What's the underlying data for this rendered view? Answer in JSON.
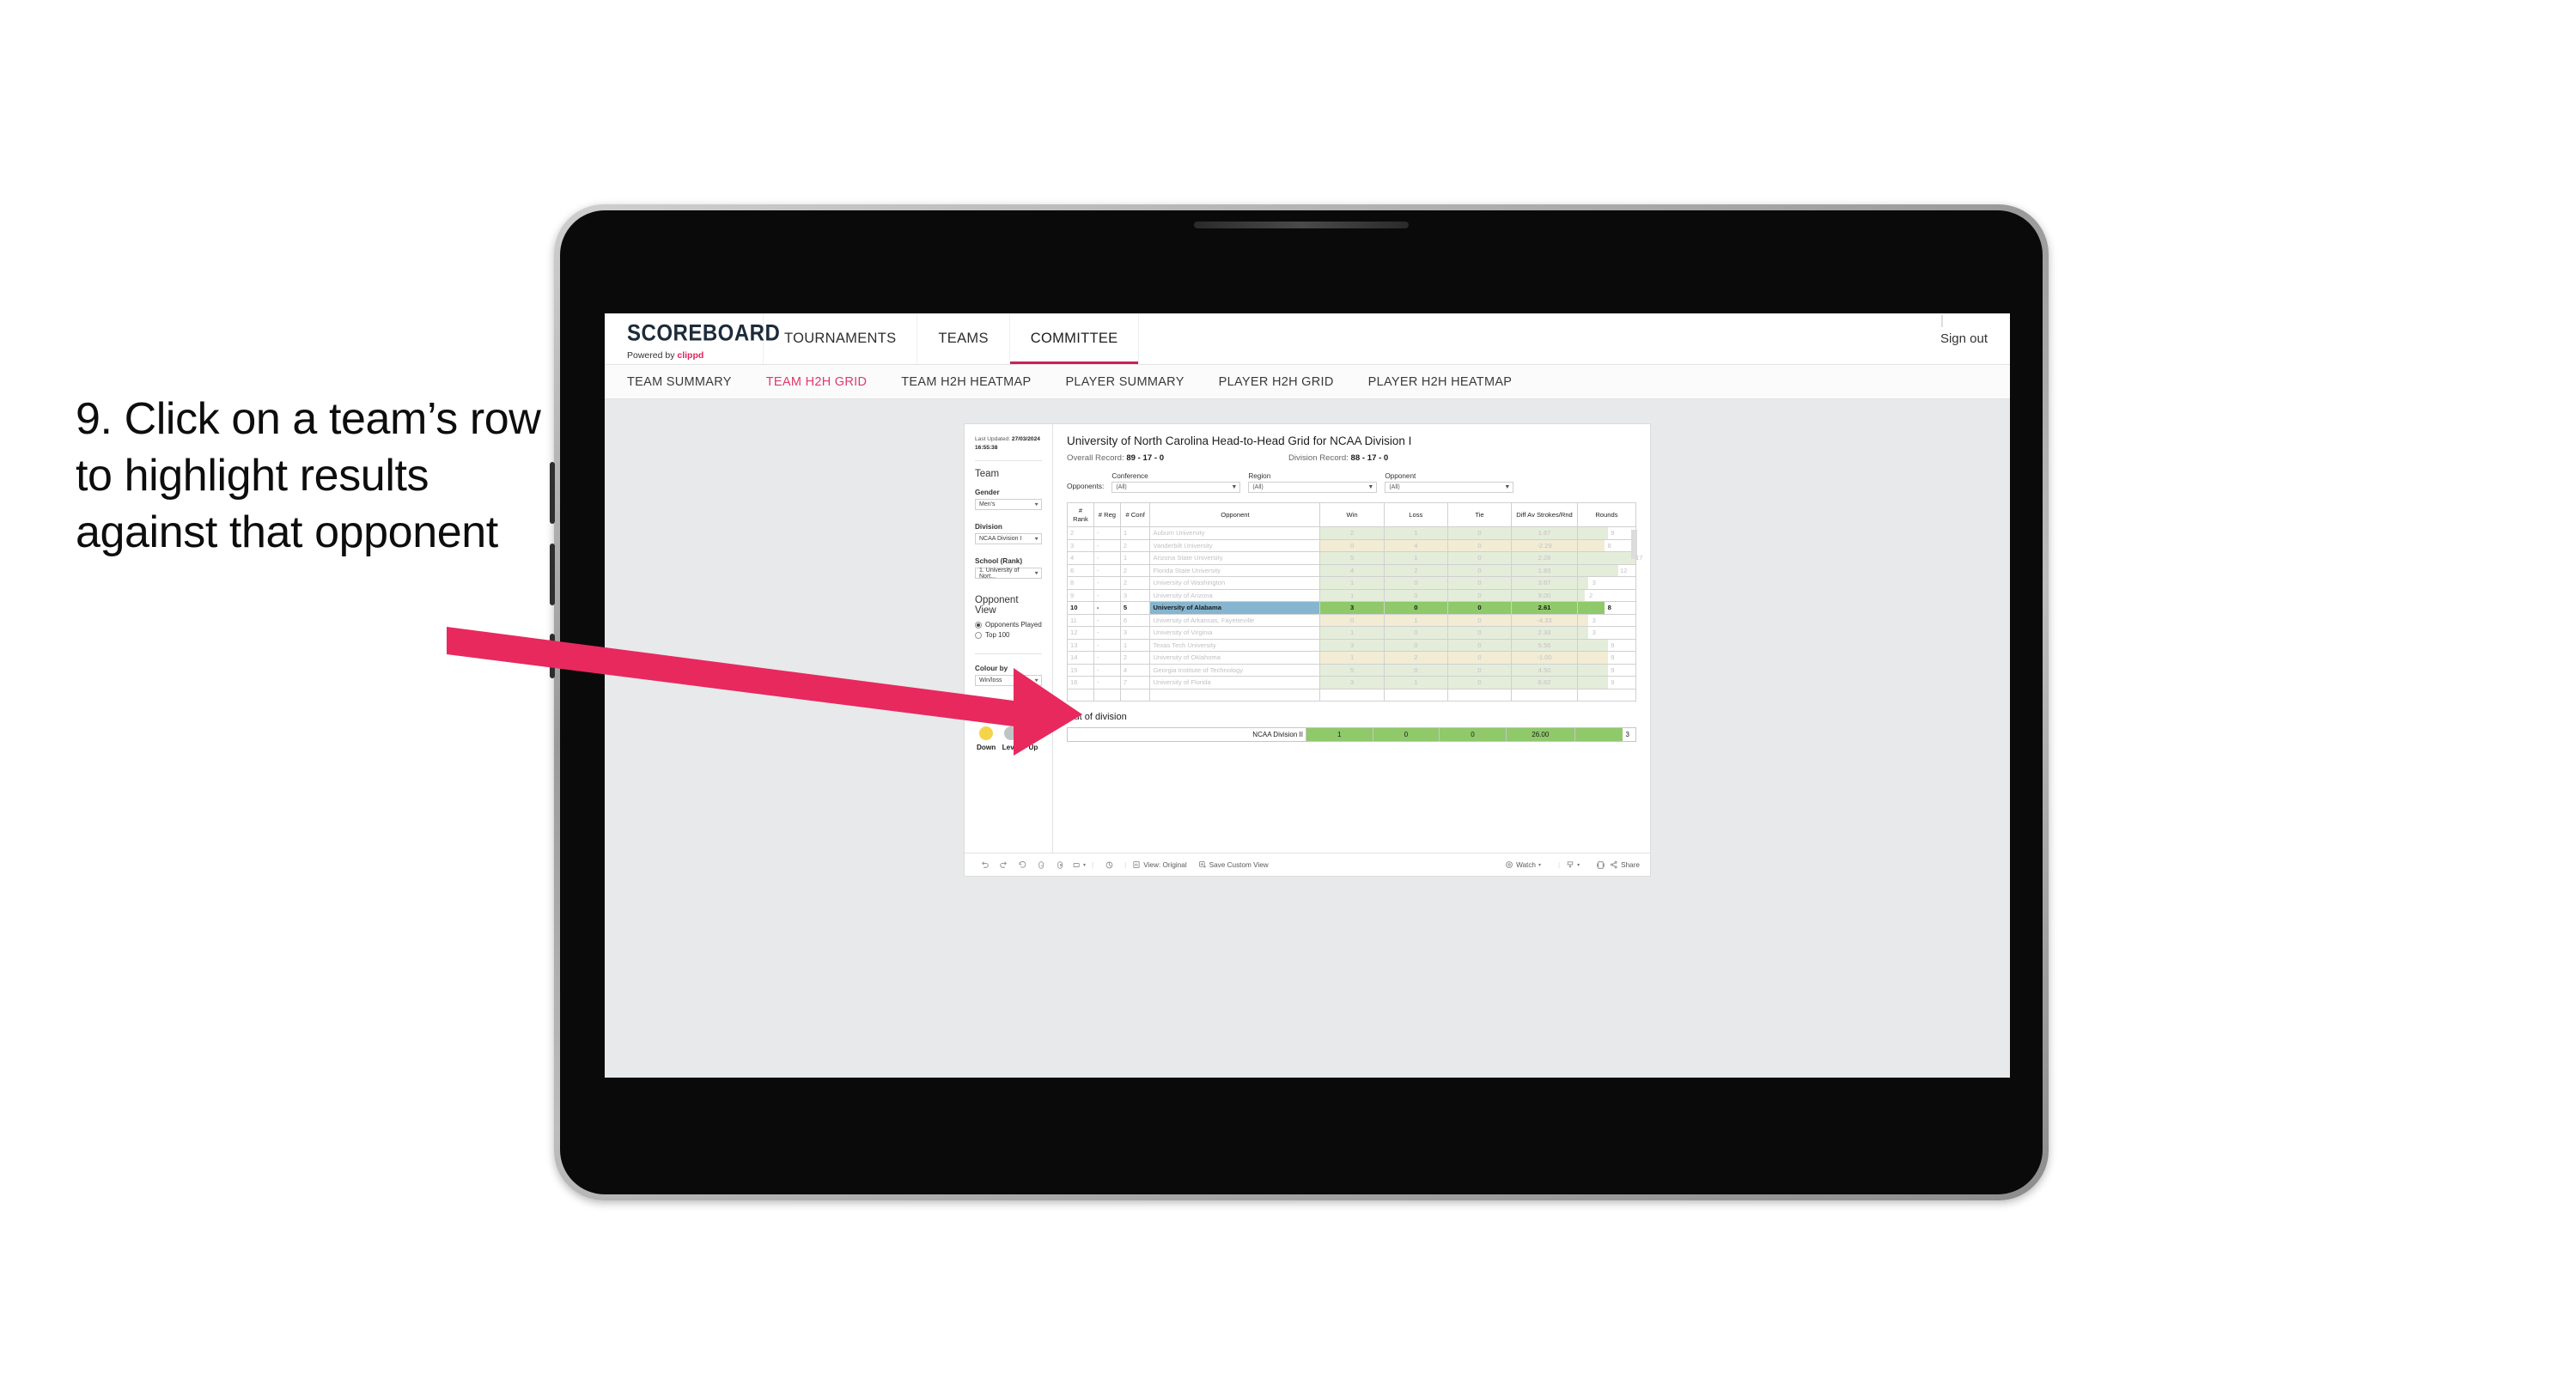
{
  "caption": {
    "text": "9. Click on a team’s row to highlight results against that opponent"
  },
  "app": {
    "brand": {
      "title": "SCOREBOARD",
      "powered_by": "Powered by",
      "vendor": "clippd"
    },
    "top_nav": [
      {
        "label": "TOURNAMENTS",
        "active": false
      },
      {
        "label": "TEAMS",
        "active": false
      },
      {
        "label": "COMMITTEE",
        "active": true
      }
    ],
    "sign_out": "Sign out",
    "sub_nav": [
      {
        "label": "TEAM SUMMARY",
        "active": false
      },
      {
        "label": "TEAM H2H GRID",
        "active": true
      },
      {
        "label": "TEAM H2H HEATMAP",
        "active": false
      },
      {
        "label": "PLAYER SUMMARY",
        "active": false
      },
      {
        "label": "PLAYER H2H GRID",
        "active": false
      },
      {
        "label": "PLAYER H2H HEATMAP",
        "active": false
      }
    ]
  },
  "sidebar": {
    "last_updated_label": "Last Updated:",
    "last_updated_value": "27/03/2024 16:55:38",
    "team_heading": "Team",
    "gender_label": "Gender",
    "gender_value": "Men’s",
    "division_label": "Division",
    "division_value": "NCAA Division I",
    "school_label": "School (Rank)",
    "school_value": "1. University of Nort...",
    "opponent_view_heading": "Opponent View",
    "opponent_view_options": [
      {
        "label": "Opponents Played",
        "selected": true
      },
      {
        "label": "Top 100",
        "selected": false
      }
    ],
    "colour_by_label": "Colour by",
    "colour_by_value": "Win/loss",
    "legend": [
      {
        "label": "Down",
        "color": "#f5d44c"
      },
      {
        "label": "Level",
        "color": "#c0c4c7"
      },
      {
        "label": "Up",
        "color": "#8ac565"
      }
    ]
  },
  "main": {
    "title": "University of North Carolina Head-to-Head Grid for NCAA Division I",
    "overall_record_label": "Overall Record:",
    "overall_record_value": "89 - 17 - 0",
    "division_record_label": "Division Record:",
    "division_record_value": "88 - 17 - 0",
    "opponents_label": "Opponents:",
    "filters": [
      {
        "label": "Conference",
        "value": "(All)"
      },
      {
        "label": "Region",
        "value": "(All)"
      },
      {
        "label": "Opponent",
        "value": "(All)"
      }
    ],
    "columns": [
      "# Rank",
      "# Reg",
      "# Conf",
      "Opponent",
      "Win",
      "Loss",
      "Tie",
      "Diff Av Strokes/Rnd",
      "Rounds"
    ],
    "rows": [
      {
        "rank": "2",
        "reg": "-",
        "conf": "1",
        "opponent": "Auburn University",
        "win": "2",
        "loss": "1",
        "tie": "0",
        "diff": "1.67",
        "rounds": "9",
        "tone": "up",
        "selected": false
      },
      {
        "rank": "3",
        "reg": "-",
        "conf": "2",
        "opponent": "Vanderbilt University",
        "win": "0",
        "loss": "4",
        "tie": "0",
        "diff": "-2.29",
        "rounds": "8",
        "tone": "down",
        "selected": false
      },
      {
        "rank": "4",
        "reg": "-",
        "conf": "1",
        "opponent": "Arizona State University",
        "win": "5",
        "loss": "1",
        "tie": "0",
        "diff": "2.28",
        "rounds": "17",
        "tone": "up",
        "selected": false
      },
      {
        "rank": "6",
        "reg": "-",
        "conf": "2",
        "opponent": "Florida State University",
        "win": "4",
        "loss": "2",
        "tie": "0",
        "diff": "1.83",
        "rounds": "12",
        "tone": "up",
        "selected": false
      },
      {
        "rank": "8",
        "reg": "-",
        "conf": "2",
        "opponent": "University of Washington",
        "win": "1",
        "loss": "0",
        "tie": "0",
        "diff": "3.67",
        "rounds": "3",
        "tone": "up",
        "selected": false
      },
      {
        "rank": "9",
        "reg": "-",
        "conf": "3",
        "opponent": "University of Arizona",
        "win": "1",
        "loss": "0",
        "tie": "0",
        "diff": "9.00",
        "rounds": "2",
        "tone": "up",
        "selected": false
      },
      {
        "rank": "10",
        "reg": "-",
        "conf": "5",
        "opponent": "University of Alabama",
        "win": "3",
        "loss": "0",
        "tie": "0",
        "diff": "2.61",
        "rounds": "8",
        "tone": "up",
        "selected": true
      },
      {
        "rank": "11",
        "reg": "-",
        "conf": "6",
        "opponent": "University of Arkansas, Fayetteville",
        "win": "0",
        "loss": "1",
        "tie": "0",
        "diff": "-4.33",
        "rounds": "3",
        "tone": "down",
        "selected": false
      },
      {
        "rank": "12",
        "reg": "-",
        "conf": "3",
        "opponent": "University of Virginia",
        "win": "1",
        "loss": "0",
        "tie": "0",
        "diff": "2.33",
        "rounds": "3",
        "tone": "up",
        "selected": false
      },
      {
        "rank": "13",
        "reg": "-",
        "conf": "1",
        "opponent": "Texas Tech University",
        "win": "3",
        "loss": "0",
        "tie": "0",
        "diff": "5.56",
        "rounds": "9",
        "tone": "up",
        "selected": false
      },
      {
        "rank": "14",
        "reg": "-",
        "conf": "2",
        "opponent": "University of Oklahoma",
        "win": "1",
        "loss": "2",
        "tie": "0",
        "diff": "-1.00",
        "rounds": "9",
        "tone": "down",
        "selected": false
      },
      {
        "rank": "15",
        "reg": "-",
        "conf": "4",
        "opponent": "Georgia Institute of Technology",
        "win": "5",
        "loss": "0",
        "tie": "0",
        "diff": "4.50",
        "rounds": "9",
        "tone": "up",
        "selected": false
      },
      {
        "rank": "16",
        "reg": "-",
        "conf": "7",
        "opponent": "University of Florida",
        "win": "3",
        "loss": "1",
        "tie": "0",
        "diff": "6.62",
        "rounds": "9",
        "tone": "up",
        "selected": false
      }
    ],
    "out_of_division_heading": "Out of division",
    "out_of_division_row": {
      "label": "NCAA Division II",
      "win": "1",
      "loss": "0",
      "tie": "0",
      "diff": "26.00",
      "rounds": "3"
    }
  },
  "toolbar": {
    "view_label": "View: Original",
    "save_label": "Save Custom View",
    "watch_label": "Watch",
    "share_label": "Share"
  },
  "colors": {
    "accent": "#e0386b",
    "brand_pink": "#e5215b",
    "selected_opponent": "#86b5cf",
    "selected_data": "#8fc96a",
    "up_faded": "#e4edda",
    "down_faded": "#f2ecd5",
    "rounds_bar": "#e9e9e9"
  }
}
